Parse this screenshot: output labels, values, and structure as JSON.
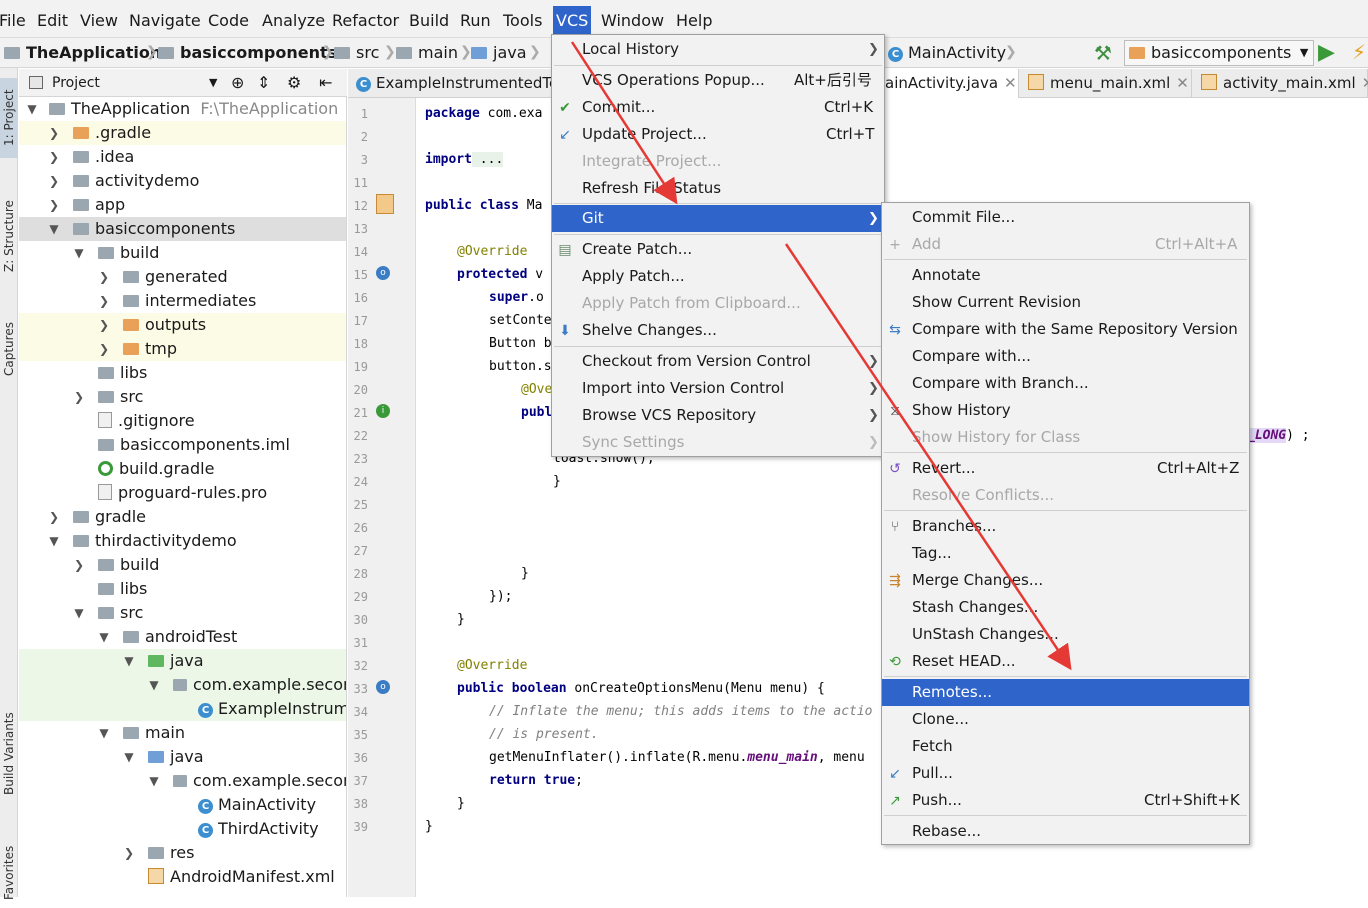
{
  "menubar": [
    "File",
    "Edit",
    "View",
    "Navigate",
    "Code",
    "Analyze",
    "Refactor",
    "Build",
    "Run",
    "Tools",
    "VCS",
    "Window",
    "Help"
  ],
  "navbar": {
    "crumbs": [
      "TheApplication",
      "basiccomponents",
      "src",
      "main",
      "java"
    ],
    "right_crumb": "MainActivity",
    "run_config": "basiccomponents"
  },
  "project_panel": {
    "title": "Project",
    "tree": [
      {
        "label": "TheApplication",
        "extra": "F:\\TheApplication"
      },
      {
        "label": ".gradle"
      },
      {
        "label": ".idea"
      },
      {
        "label": "activitydemo"
      },
      {
        "label": "app"
      },
      {
        "label": "basiccomponents"
      },
      {
        "label": "build"
      },
      {
        "label": "generated"
      },
      {
        "label": "intermediates"
      },
      {
        "label": "outputs"
      },
      {
        "label": "tmp"
      },
      {
        "label": "libs"
      },
      {
        "label": "src"
      },
      {
        "label": ".gitignore"
      },
      {
        "label": "basiccomponents.iml"
      },
      {
        "label": "build.gradle"
      },
      {
        "label": "proguard-rules.pro"
      },
      {
        "label": "gradle"
      },
      {
        "label": "thirdactivitydemo"
      },
      {
        "label": "build"
      },
      {
        "label": "libs"
      },
      {
        "label": "src"
      },
      {
        "label": "androidTest"
      },
      {
        "label": "java"
      },
      {
        "label": "com.example.seconc"
      },
      {
        "label": "ExampleInstrume"
      },
      {
        "label": "main"
      },
      {
        "label": "java"
      },
      {
        "label": "com.example.seconc"
      },
      {
        "label": "MainActivity"
      },
      {
        "label": "ThirdActivity"
      },
      {
        "label": "res"
      },
      {
        "label": "AndroidManifest.xml"
      }
    ]
  },
  "left_tool_tabs": [
    "1: Project",
    "Z: Structure",
    "Captures",
    "Build Variants",
    "Favorites"
  ],
  "editor_tabs": [
    "ExampleInstrumentedTe",
    "ainActivity.java",
    "menu_main.xml",
    "activity_main.xml"
  ],
  "line_numbers": [
    "1",
    "2",
    "3",
    "11",
    "12",
    "13",
    "14",
    "15",
    "16",
    "17",
    "18",
    "19",
    "20",
    "21",
    "22",
    "23",
    "24",
    "25",
    "26",
    "27",
    "28",
    "29",
    "30",
    "31",
    "32",
    "33",
    "34",
    "35",
    "36",
    "37",
    "38",
    "39"
  ],
  "code_lines": {
    "l1a": "package",
    "l1b": " com.exa",
    "l3a": "import",
    "l3b": " ...",
    "l12a": "public class",
    "l12b": " Ma",
    "l14": "@Override",
    "l15a": "protected",
    "l15b": " v",
    "l16a": "super",
    "l16b": ".o",
    "l17": "setConte",
    "l18": "Button b",
    "l19": "button.s",
    "l20": "@Ove",
    "l21": "publ",
    "l22a": "_LONG",
    "l22b": ")",
    "l23": "toast.show();",
    "l24": "}",
    "l28": "}",
    "l29": "});",
    "l30": "}",
    "l32": "@Override",
    "l33a": "public boolean",
    "l33b": " onCreateOptionsMenu(Menu menu) {",
    "l34": "// Inflate the menu; this adds items to the actio",
    "l35": "// is present.",
    "l36a": "getMenuInflater().inflate(R.menu.",
    "l36b": "menu_main",
    "l36c": ", menu",
    "l37a": "return true",
    "l37b": ";",
    "l38": "}",
    "l39": "}"
  },
  "vcs_menu": [
    {
      "label": "Local History",
      "shortcut": "",
      "submenu": true,
      "disabled": false
    },
    {
      "label": "VCS Operations Popup...",
      "shortcut": "Alt+后引号",
      "submenu": false,
      "disabled": false
    },
    {
      "label": "Commit...",
      "shortcut": "Ctrl+K",
      "submenu": false,
      "disabled": false
    },
    {
      "label": "Update Project...",
      "shortcut": "Ctrl+T",
      "submenu": false,
      "disabled": false
    },
    {
      "label": "Integrate Project...",
      "shortcut": "",
      "submenu": false,
      "disabled": true
    },
    {
      "label": "Refresh File Status",
      "shortcut": "",
      "submenu": false,
      "disabled": false
    },
    {
      "label": "Git",
      "shortcut": "",
      "submenu": true,
      "disabled": false,
      "selected": true
    },
    {
      "label": "Create Patch...",
      "shortcut": "",
      "submenu": false,
      "disabled": false
    },
    {
      "label": "Apply Patch...",
      "shortcut": "",
      "submenu": false,
      "disabled": false
    },
    {
      "label": "Apply Patch from Clipboard...",
      "shortcut": "",
      "submenu": false,
      "disabled": true
    },
    {
      "label": "Shelve Changes...",
      "shortcut": "",
      "submenu": false,
      "disabled": false
    },
    {
      "label": "Checkout from Version Control",
      "shortcut": "",
      "submenu": true,
      "disabled": false
    },
    {
      "label": "Import into Version Control",
      "shortcut": "",
      "submenu": true,
      "disabled": false
    },
    {
      "label": "Browse VCS Repository",
      "shortcut": "",
      "submenu": true,
      "disabled": false
    },
    {
      "label": "Sync Settings",
      "shortcut": "",
      "submenu": true,
      "disabled": true
    }
  ],
  "git_menu": [
    {
      "label": "Commit File...",
      "shortcut": "",
      "disabled": false
    },
    {
      "label": "Add",
      "shortcut": "Ctrl+Alt+A",
      "disabled": true
    },
    {
      "label": "Annotate",
      "shortcut": "",
      "disabled": false
    },
    {
      "label": "Show Current Revision",
      "shortcut": "",
      "disabled": false
    },
    {
      "label": "Compare with the Same Repository Version",
      "shortcut": "",
      "disabled": false
    },
    {
      "label": "Compare with...",
      "shortcut": "",
      "disabled": false
    },
    {
      "label": "Compare with Branch...",
      "shortcut": "",
      "disabled": false
    },
    {
      "label": "Show History",
      "shortcut": "",
      "disabled": false
    },
    {
      "label": "Show History for Class",
      "shortcut": "",
      "disabled": true
    },
    {
      "label": "Revert...",
      "shortcut": "Ctrl+Alt+Z",
      "disabled": false
    },
    {
      "label": "Resolve Conflicts...",
      "shortcut": "",
      "disabled": true
    },
    {
      "label": "Branches...",
      "shortcut": "",
      "disabled": false
    },
    {
      "label": "Tag...",
      "shortcut": "",
      "disabled": false
    },
    {
      "label": "Merge Changes...",
      "shortcut": "",
      "disabled": false
    },
    {
      "label": "Stash Changes...",
      "shortcut": "",
      "disabled": false
    },
    {
      "label": "UnStash Changes...",
      "shortcut": "",
      "disabled": false
    },
    {
      "label": "Reset HEAD...",
      "shortcut": "",
      "disabled": false
    },
    {
      "label": "Remotes...",
      "shortcut": "",
      "disabled": false,
      "selected": true
    },
    {
      "label": "Clone...",
      "shortcut": "",
      "disabled": false
    },
    {
      "label": "Fetch",
      "shortcut": "",
      "disabled": false
    },
    {
      "label": "Pull...",
      "shortcut": "",
      "disabled": false
    },
    {
      "label": "Push...",
      "shortcut": "Ctrl+Shift+K",
      "disabled": false
    },
    {
      "label": "Rebase...",
      "shortcut": "",
      "disabled": false
    }
  ],
  "colors": {
    "selection": "#2f65ca",
    "annotation_arrow": "#e53935"
  }
}
